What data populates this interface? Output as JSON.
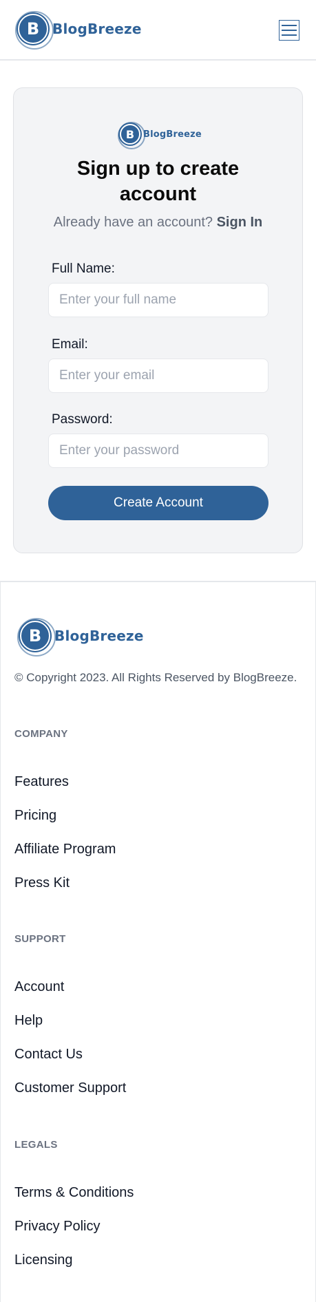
{
  "brand": {
    "name": "BlogBreeze",
    "logo_letter": "B",
    "color": "#2f6298"
  },
  "header": {
    "menu_icon": "hamburger-menu-icon"
  },
  "signup": {
    "title": "Sign up to create account",
    "prompt": "Already have an account?",
    "signin_label": "Sign In",
    "fields": [
      {
        "label": "Full Name:",
        "placeholder": "Enter your full name",
        "value": ""
      },
      {
        "label": "Email:",
        "placeholder": "Enter your email",
        "value": ""
      },
      {
        "label": "Password:",
        "placeholder": "Enter your password",
        "value": ""
      }
    ],
    "submit_label": "Create Account"
  },
  "footer": {
    "copyright": "© Copyright 2023. All Rights Reserved by BlogBreeze.",
    "sections": [
      {
        "heading": "COMPANY",
        "links": [
          "Features",
          "Pricing",
          "Affiliate Program",
          "Press Kit"
        ]
      },
      {
        "heading": "SUPPORT",
        "links": [
          "Account",
          "Help",
          "Contact Us",
          "Customer Support"
        ]
      },
      {
        "heading": "LEGALS",
        "links": [
          "Terms & Conditions",
          "Privacy Policy",
          "Licensing"
        ]
      }
    ]
  }
}
